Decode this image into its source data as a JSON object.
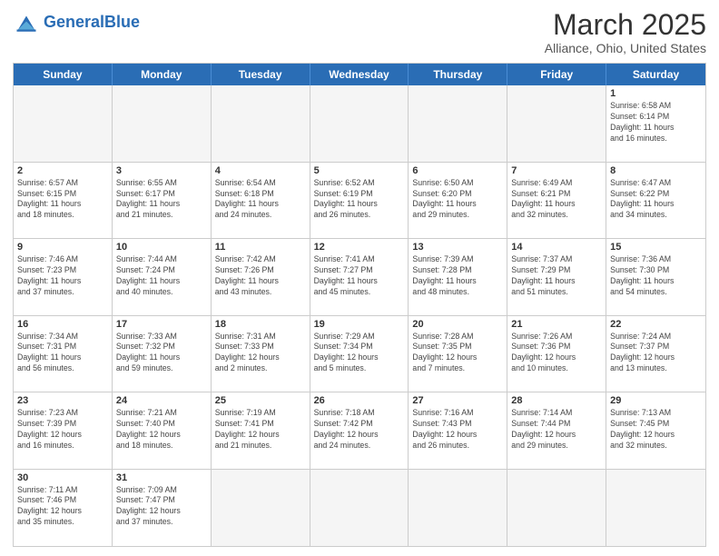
{
  "header": {
    "logo_general": "General",
    "logo_blue": "Blue",
    "title": "March 2025",
    "subtitle": "Alliance, Ohio, United States"
  },
  "days_of_week": [
    "Sunday",
    "Monday",
    "Tuesday",
    "Wednesday",
    "Thursday",
    "Friday",
    "Saturday"
  ],
  "weeks": [
    [
      {
        "day": "",
        "info": ""
      },
      {
        "day": "",
        "info": ""
      },
      {
        "day": "",
        "info": ""
      },
      {
        "day": "",
        "info": ""
      },
      {
        "day": "",
        "info": ""
      },
      {
        "day": "",
        "info": ""
      },
      {
        "day": "1",
        "info": "Sunrise: 6:58 AM\nSunset: 6:14 PM\nDaylight: 11 hours\nand 16 minutes."
      }
    ],
    [
      {
        "day": "2",
        "info": "Sunrise: 6:57 AM\nSunset: 6:15 PM\nDaylight: 11 hours\nand 18 minutes."
      },
      {
        "day": "3",
        "info": "Sunrise: 6:55 AM\nSunset: 6:17 PM\nDaylight: 11 hours\nand 21 minutes."
      },
      {
        "day": "4",
        "info": "Sunrise: 6:54 AM\nSunset: 6:18 PM\nDaylight: 11 hours\nand 24 minutes."
      },
      {
        "day": "5",
        "info": "Sunrise: 6:52 AM\nSunset: 6:19 PM\nDaylight: 11 hours\nand 26 minutes."
      },
      {
        "day": "6",
        "info": "Sunrise: 6:50 AM\nSunset: 6:20 PM\nDaylight: 11 hours\nand 29 minutes."
      },
      {
        "day": "7",
        "info": "Sunrise: 6:49 AM\nSunset: 6:21 PM\nDaylight: 11 hours\nand 32 minutes."
      },
      {
        "day": "8",
        "info": "Sunrise: 6:47 AM\nSunset: 6:22 PM\nDaylight: 11 hours\nand 34 minutes."
      }
    ],
    [
      {
        "day": "9",
        "info": "Sunrise: 7:46 AM\nSunset: 7:23 PM\nDaylight: 11 hours\nand 37 minutes."
      },
      {
        "day": "10",
        "info": "Sunrise: 7:44 AM\nSunset: 7:24 PM\nDaylight: 11 hours\nand 40 minutes."
      },
      {
        "day": "11",
        "info": "Sunrise: 7:42 AM\nSunset: 7:26 PM\nDaylight: 11 hours\nand 43 minutes."
      },
      {
        "day": "12",
        "info": "Sunrise: 7:41 AM\nSunset: 7:27 PM\nDaylight: 11 hours\nand 45 minutes."
      },
      {
        "day": "13",
        "info": "Sunrise: 7:39 AM\nSunset: 7:28 PM\nDaylight: 11 hours\nand 48 minutes."
      },
      {
        "day": "14",
        "info": "Sunrise: 7:37 AM\nSunset: 7:29 PM\nDaylight: 11 hours\nand 51 minutes."
      },
      {
        "day": "15",
        "info": "Sunrise: 7:36 AM\nSunset: 7:30 PM\nDaylight: 11 hours\nand 54 minutes."
      }
    ],
    [
      {
        "day": "16",
        "info": "Sunrise: 7:34 AM\nSunset: 7:31 PM\nDaylight: 11 hours\nand 56 minutes."
      },
      {
        "day": "17",
        "info": "Sunrise: 7:33 AM\nSunset: 7:32 PM\nDaylight: 11 hours\nand 59 minutes."
      },
      {
        "day": "18",
        "info": "Sunrise: 7:31 AM\nSunset: 7:33 PM\nDaylight: 12 hours\nand 2 minutes."
      },
      {
        "day": "19",
        "info": "Sunrise: 7:29 AM\nSunset: 7:34 PM\nDaylight: 12 hours\nand 5 minutes."
      },
      {
        "day": "20",
        "info": "Sunrise: 7:28 AM\nSunset: 7:35 PM\nDaylight: 12 hours\nand 7 minutes."
      },
      {
        "day": "21",
        "info": "Sunrise: 7:26 AM\nSunset: 7:36 PM\nDaylight: 12 hours\nand 10 minutes."
      },
      {
        "day": "22",
        "info": "Sunrise: 7:24 AM\nSunset: 7:37 PM\nDaylight: 12 hours\nand 13 minutes."
      }
    ],
    [
      {
        "day": "23",
        "info": "Sunrise: 7:23 AM\nSunset: 7:39 PM\nDaylight: 12 hours\nand 16 minutes."
      },
      {
        "day": "24",
        "info": "Sunrise: 7:21 AM\nSunset: 7:40 PM\nDaylight: 12 hours\nand 18 minutes."
      },
      {
        "day": "25",
        "info": "Sunrise: 7:19 AM\nSunset: 7:41 PM\nDaylight: 12 hours\nand 21 minutes."
      },
      {
        "day": "26",
        "info": "Sunrise: 7:18 AM\nSunset: 7:42 PM\nDaylight: 12 hours\nand 24 minutes."
      },
      {
        "day": "27",
        "info": "Sunrise: 7:16 AM\nSunset: 7:43 PM\nDaylight: 12 hours\nand 26 minutes."
      },
      {
        "day": "28",
        "info": "Sunrise: 7:14 AM\nSunset: 7:44 PM\nDaylight: 12 hours\nand 29 minutes."
      },
      {
        "day": "29",
        "info": "Sunrise: 7:13 AM\nSunset: 7:45 PM\nDaylight: 12 hours\nand 32 minutes."
      }
    ],
    [
      {
        "day": "30",
        "info": "Sunrise: 7:11 AM\nSunset: 7:46 PM\nDaylight: 12 hours\nand 35 minutes."
      },
      {
        "day": "31",
        "info": "Sunrise: 7:09 AM\nSunset: 7:47 PM\nDaylight: 12 hours\nand 37 minutes."
      },
      {
        "day": "",
        "info": ""
      },
      {
        "day": "",
        "info": ""
      },
      {
        "day": "",
        "info": ""
      },
      {
        "day": "",
        "info": ""
      },
      {
        "day": "",
        "info": ""
      }
    ]
  ]
}
